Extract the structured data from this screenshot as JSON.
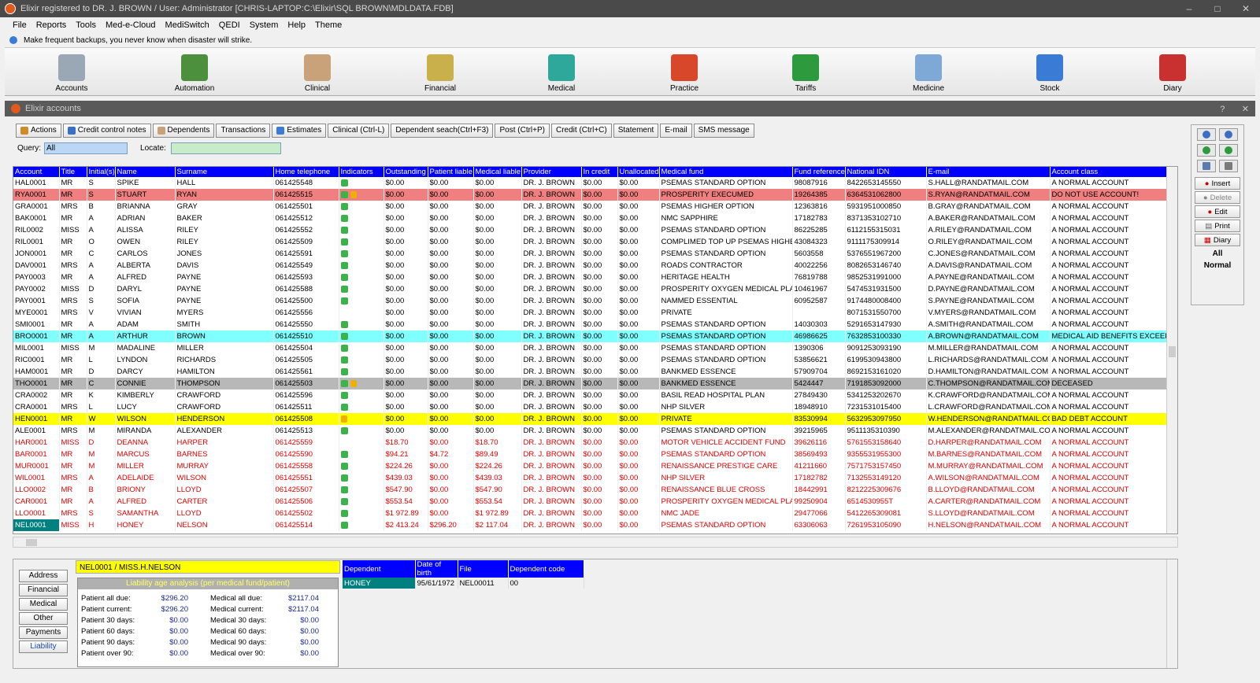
{
  "window": {
    "title": "Elixir registered to DR. J. BROWN / User: Administrator [CHRIS-LAPTOP:C:\\Elixir\\SQL BROWN\\MDLDATA.FDB]",
    "minimize": "–",
    "maximize": "□",
    "close": "✕"
  },
  "menu": [
    "File",
    "Reports",
    "Tools",
    "Med-e-Cloud",
    "MediSwitch",
    "QEDI",
    "System",
    "Help",
    "Theme"
  ],
  "info": "Make frequent backups, you never know when disaster will strike.",
  "modules": [
    {
      "label": "Accounts",
      "color": "#9aa7b4"
    },
    {
      "label": "Automation",
      "color": "#4c8f3c"
    },
    {
      "label": "Clinical",
      "color": "#c9a27a"
    },
    {
      "label": "Financial",
      "color": "#c9b04a"
    },
    {
      "label": "Medical",
      "color": "#2fa89c"
    },
    {
      "label": "Practice",
      "color": "#d9472a"
    },
    {
      "label": "Tariffs",
      "color": "#2e9a3e"
    },
    {
      "label": "Medicine",
      "color": "#7ea9d6"
    },
    {
      "label": "Stock",
      "color": "#3a7bd5"
    },
    {
      "label": "Diary",
      "color": "#c93030"
    }
  ],
  "subwindow": {
    "title": "Elixir accounts",
    "help": "?",
    "close": "✕"
  },
  "toolbar": [
    "Actions",
    "Credit control notes",
    "Dependents",
    "Transactions",
    "Estimates",
    "Clinical (Ctrl-L)",
    "Dependent seach(Ctrl+F3)",
    "Post (Ctrl+P)",
    "Credit (Ctrl+C)",
    "Statement",
    "E-mail",
    "SMS message"
  ],
  "query": {
    "label": "Query:",
    "value": "All",
    "locate_label": "Locate:",
    "locate_value": ""
  },
  "columns": [
    "Account",
    "Title",
    "Initial(s)",
    "Name",
    "Surname",
    "Home telephone",
    "Indicators",
    "Outstanding",
    "Patient liable",
    "Medical liable",
    "Provider",
    "In credit",
    "Unallocated",
    "Medical fund",
    "Fund reference",
    "National IDN",
    "E-mail",
    "Account class"
  ],
  "rows": [
    {
      "c": [
        "HAL0001",
        "MR",
        "S",
        "SPIKE",
        "HALL",
        "061425548",
        "",
        "$0.00",
        "$0.00",
        "$0.00",
        "DR. J. BROWN",
        "$0.00",
        "$0.00",
        "PSEMAS STANDARD OPTION",
        "98087916",
        "8422653145550",
        "S.HALL@RANDATMAIL.COM",
        "A NORMAL ACCOUNT"
      ],
      "style": "",
      "ind": 1
    },
    {
      "c": [
        "RYA0001",
        "MR",
        "S",
        "STUART",
        "RYAN",
        "061425515",
        "",
        "$0.00",
        "$0.00",
        "$0.00",
        "DR. J. BROWN",
        "$0.00",
        "$0.00",
        "PROSPERITY EXECUMED",
        "19264385",
        "6364531062800",
        "S.RYAN@RANDATMAIL.COM",
        "DO NOT USE ACCOUNT!"
      ],
      "style": "hl-red",
      "ind": 2
    },
    {
      "c": [
        "GRA0001",
        "MRS",
        "B",
        "BRIANNA",
        "GRAY",
        "061425501",
        "",
        "$0.00",
        "$0.00",
        "$0.00",
        "DR. J. BROWN",
        "$0.00",
        "$0.00",
        "PSEMAS HIGHER OPTION",
        "12363816",
        "5931951000850",
        "B.GRAY@RANDATMAIL.COM",
        "A NORMAL ACCOUNT"
      ],
      "style": "",
      "ind": 1
    },
    {
      "c": [
        "BAK0001",
        "MR",
        "A",
        "ADRIAN",
        "BAKER",
        "061425512",
        "",
        "$0.00",
        "$0.00",
        "$0.00",
        "DR. J. BROWN",
        "$0.00",
        "$0.00",
        "NMC SAPPHIRE",
        "17182783",
        "8371353102710",
        "A.BAKER@RANDATMAIL.COM",
        "A NORMAL ACCOUNT"
      ],
      "style": "",
      "ind": 1
    },
    {
      "c": [
        "RIL0002",
        "MISS",
        "A",
        "ALISSA",
        "RILEY",
        "061425552",
        "",
        "$0.00",
        "$0.00",
        "$0.00",
        "DR. J. BROWN",
        "$0.00",
        "$0.00",
        "PSEMAS STANDARD OPTION",
        "86225285",
        "6112155315031",
        "A.RILEY@RANDATMAIL.COM",
        "A NORMAL ACCOUNT"
      ],
      "style": "",
      "ind": 1
    },
    {
      "c": [
        "RIL0001",
        "MR",
        "O",
        "OWEN",
        "RILEY",
        "061425509",
        "",
        "$0.00",
        "$0.00",
        "$0.00",
        "DR. J. BROWN",
        "$0.00",
        "$0.00",
        "COMPLIMED TOP UP PSEMAS HIGHER",
        "43084323",
        "9111175309914",
        "O.RILEY@RANDATMAIL.COM",
        "A NORMAL ACCOUNT"
      ],
      "style": "",
      "ind": 1
    },
    {
      "c": [
        "JON0001",
        "MR",
        "C",
        "CARLOS",
        "JONES",
        "061425591",
        "",
        "$0.00",
        "$0.00",
        "$0.00",
        "DR. J. BROWN",
        "$0.00",
        "$0.00",
        "PSEMAS STANDARD OPTION",
        "5603558",
        "5376551967200",
        "C.JONES@RANDATMAIL.COM",
        "A NORMAL ACCOUNT"
      ],
      "style": "",
      "ind": 1
    },
    {
      "c": [
        "DAV0001",
        "MRS",
        "A",
        "ALBERTA",
        "DAVIS",
        "061425549",
        "",
        "$0.00",
        "$0.00",
        "$0.00",
        "DR. J. BROWN",
        "$0.00",
        "$0.00",
        "ROADS CONTRACTOR",
        "40022256",
        "8082653146740",
        "A.DAVIS@RANDATMAIL.COM",
        "A NORMAL ACCOUNT"
      ],
      "style": "",
      "ind": 1
    },
    {
      "c": [
        "PAY0003",
        "MR",
        "A",
        "ALFRED",
        "PAYNE",
        "061425593",
        "",
        "$0.00",
        "$0.00",
        "$0.00",
        "DR. J. BROWN",
        "$0.00",
        "$0.00",
        "HERITAGE HEALTH",
        "76819788",
        "9852531991000",
        "A.PAYNE@RANDATMAIL.COM",
        "A NORMAL ACCOUNT"
      ],
      "style": "",
      "ind": 1
    },
    {
      "c": [
        "PAY0002",
        "MISS",
        "D",
        "DARYL",
        "PAYNE",
        "061425588",
        "",
        "$0.00",
        "$0.00",
        "$0.00",
        "DR. J. BROWN",
        "$0.00",
        "$0.00",
        "PROSPERITY OXYGEN MEDICAL PLAN",
        "10461967",
        "5474531931500",
        "D.PAYNE@RANDATMAIL.COM",
        "A NORMAL ACCOUNT"
      ],
      "style": "",
      "ind": 1
    },
    {
      "c": [
        "PAY0001",
        "MRS",
        "S",
        "SOFIA",
        "PAYNE",
        "061425500",
        "",
        "$0.00",
        "$0.00",
        "$0.00",
        "DR. J. BROWN",
        "$0.00",
        "$0.00",
        "NAMMED ESSENTIAL",
        "60952587",
        "9174480008400",
        "S.PAYNE@RANDATMAIL.COM",
        "A NORMAL ACCOUNT"
      ],
      "style": "",
      "ind": 1
    },
    {
      "c": [
        "MYE0001",
        "MRS",
        "V",
        "VIVIAN",
        "MYERS",
        "061425556",
        "",
        "$0.00",
        "$0.00",
        "$0.00",
        "DR. J. BROWN",
        "$0.00",
        "$0.00",
        "PRIVATE",
        "",
        "8071531550700",
        "V.MYERS@RANDATMAIL.COM",
        "A NORMAL ACCOUNT"
      ],
      "style": "",
      "ind": 0
    },
    {
      "c": [
        "SMI0001",
        "MR",
        "A",
        "ADAM",
        "SMITH",
        "061425550",
        "",
        "$0.00",
        "$0.00",
        "$0.00",
        "DR. J. BROWN",
        "$0.00",
        "$0.00",
        "PSEMAS STANDARD OPTION",
        "14030303",
        "5291653147930",
        "A.SMITH@RANDATMAIL.COM",
        "A NORMAL ACCOUNT"
      ],
      "style": "",
      "ind": 1
    },
    {
      "c": [
        "BRO0001",
        "MR",
        "A",
        "ARTHUR",
        "BROWN",
        "061425510",
        "",
        "$0.00",
        "$0.00",
        "$0.00",
        "DR. J. BROWN",
        "$0.00",
        "$0.00",
        "PSEMAS STANDARD OPTION",
        "46986625",
        "7632853100330",
        "A.BROWN@RANDATMAIL.COM",
        "MEDICAL AID BENEFITS EXCEEDED"
      ],
      "style": "hl-cyan",
      "ind": 1
    },
    {
      "c": [
        "MIL0001",
        "MISS",
        "M",
        "MADALINE",
        "MILLER",
        "061425504",
        "",
        "$0.00",
        "$0.00",
        "$0.00",
        "DR. J. BROWN",
        "$0.00",
        "$0.00",
        "PSEMAS STANDARD OPTION",
        "1390306",
        "9091253093190",
        "M.MILLER@RANDATMAIL.COM",
        "A NORMAL ACCOUNT"
      ],
      "style": "",
      "ind": 1
    },
    {
      "c": [
        "RIC0001",
        "MR",
        "L",
        "LYNDON",
        "RICHARDS",
        "061425505",
        "",
        "$0.00",
        "$0.00",
        "$0.00",
        "DR. J. BROWN",
        "$0.00",
        "$0.00",
        "PSEMAS STANDARD OPTION",
        "53856621",
        "6199530943800",
        "L.RICHARDS@RANDATMAIL.COM",
        "A NORMAL ACCOUNT"
      ],
      "style": "",
      "ind": 1
    },
    {
      "c": [
        "HAM0001",
        "MR",
        "D",
        "DARCY",
        "HAMILTON",
        "061425561",
        "",
        "$0.00",
        "$0.00",
        "$0.00",
        "DR. J. BROWN",
        "$0.00",
        "$0.00",
        "BANKMED ESSENCE",
        "57909704",
        "8692153161020",
        "D.HAMILTON@RANDATMAIL.COM",
        "A NORMAL ACCOUNT"
      ],
      "style": "",
      "ind": 1
    },
    {
      "c": [
        "THO0001",
        "MR",
        "C",
        "CONNIE",
        "THOMPSON",
        "061425503",
        "",
        "$0.00",
        "$0.00",
        "$0.00",
        "DR. J. BROWN",
        "$0.00",
        "$0.00",
        "BANKMED ESSENCE",
        "5424447",
        "7191853092000",
        "C.THOMPSON@RANDATMAIL.COM",
        "DECEASED"
      ],
      "style": "hl-gray",
      "ind": 2
    },
    {
      "c": [
        "CRA0002",
        "MR",
        "K",
        "KIMBERLY",
        "CRAWFORD",
        "061425596",
        "",
        "$0.00",
        "$0.00",
        "$0.00",
        "DR. J. BROWN",
        "$0.00",
        "$0.00",
        "BASIL READ HOSPITAL PLAN",
        "27849430",
        "5341253202670",
        "K.CRAWFORD@RANDATMAIL.COM",
        "A NORMAL ACCOUNT"
      ],
      "style": "",
      "ind": 1
    },
    {
      "c": [
        "CRA0001",
        "MRS",
        "L",
        "LUCY",
        "CRAWFORD",
        "061425511",
        "",
        "$0.00",
        "$0.00",
        "$0.00",
        "DR. J. BROWN",
        "$0.00",
        "$0.00",
        "NHP SILVER",
        "18948910",
        "7231531015400",
        "L.CRAWFORD@RANDATMAIL.COM",
        "A NORMAL ACCOUNT"
      ],
      "style": "",
      "ind": 1
    },
    {
      "c": [
        "HEN0001",
        "MR",
        "W",
        "WILSON",
        "HENDERSON",
        "061425508",
        "",
        "$0.00",
        "$0.00",
        "$0.00",
        "DR. J. BROWN",
        "$0.00",
        "$0.00",
        "PRIVATE",
        "83530994",
        "5632953097950",
        "W.HENDERSON@RANDATMAIL.COM",
        "BAD DEBT ACCOUNT"
      ],
      "style": "hl-yel",
      "ind": 3
    },
    {
      "c": [
        "ALE0001",
        "MRS",
        "M",
        "MIRANDA",
        "ALEXANDER",
        "061425513",
        "",
        "$0.00",
        "$0.00",
        "$0.00",
        "DR. J. BROWN",
        "$0.00",
        "$0.00",
        "PSEMAS STANDARD OPTION",
        "39215965",
        "9511135310390",
        "M.ALEXANDER@RANDATMAIL.COM",
        "A NORMAL ACCOUNT"
      ],
      "style": "",
      "ind": 1
    },
    {
      "c": [
        "HAR0001",
        "MISS",
        "D",
        "DEANNA",
        "HARPER",
        "061425559",
        "",
        "$18.70",
        "$0.00",
        "$18.70",
        "DR. J. BROWN",
        "$0.00",
        "$0.00",
        "MOTOR VEHICLE ACCIDENT FUND",
        "39626116",
        "5761553158640",
        "D.HARPER@RANDATMAIL.COM",
        "A NORMAL ACCOUNT"
      ],
      "style": "red",
      "ind": 0
    },
    {
      "c": [
        "BAR0001",
        "MR",
        "M",
        "MARCUS",
        "BARNES",
        "061425590",
        "",
        "$94.21",
        "$4.72",
        "$89.49",
        "DR. J. BROWN",
        "$0.00",
        "$0.00",
        "PSEMAS STANDARD OPTION",
        "38569493",
        "9355531955300",
        "M.BARNES@RANDATMAIL.COM",
        "A NORMAL ACCOUNT"
      ],
      "style": "red",
      "ind": 1
    },
    {
      "c": [
        "MUR0001",
        "MR",
        "M",
        "MILLER",
        "MURRAY",
        "061425558",
        "",
        "$224.26",
        "$0.00",
        "$224.26",
        "DR. J. BROWN",
        "$0.00",
        "$0.00",
        "RENAISSANCE PRESTIGE CARE",
        "41211660",
        "7571753157450",
        "M.MURRAY@RANDATMAIL.COM",
        "A NORMAL ACCOUNT"
      ],
      "style": "red",
      "ind": 1
    },
    {
      "c": [
        "WIL0001",
        "MRS",
        "A",
        "ADELAIDE",
        "WILSON",
        "061425551",
        "",
        "$439.03",
        "$0.00",
        "$439.03",
        "DR. J. BROWN",
        "$0.00",
        "$0.00",
        "NHP SILVER",
        "17182782",
        "7132553149120",
        "A.WILSON@RANDATMAIL.COM",
        "A NORMAL ACCOUNT"
      ],
      "style": "red",
      "ind": 1
    },
    {
      "c": [
        "LLO0002",
        "MR",
        "B",
        "BRIONY",
        "LLOYD",
        "061425507",
        "",
        "$547.90",
        "$0.00",
        "$547.90",
        "DR. J. BROWN",
        "$0.00",
        "$0.00",
        "RENAISSANCE BLUE CROSS",
        "18442991",
        "8212225309676",
        "B.LLOYD@RANDATMAIL.COM",
        "A NORMAL ACCOUNT"
      ],
      "style": "red",
      "ind": 1
    },
    {
      "c": [
        "CAR0001",
        "MR",
        "A",
        "ALFRED",
        "CARTER",
        "061425506",
        "",
        "$553.54",
        "$0.00",
        "$553.54",
        "DR. J. BROWN",
        "$0.00",
        "$0.00",
        "PROSPERITY OXYGEN MEDICAL PLAN",
        "99250904",
        "6514530955T",
        "A.CARTER@RANDATMAIL.COM",
        "A NORMAL ACCOUNT"
      ],
      "style": "red",
      "ind": 1
    },
    {
      "c": [
        "LLO0001",
        "MRS",
        "S",
        "SAMANTHA",
        "LLOYD",
        "061425502",
        "",
        "$1 972.89",
        "$0.00",
        "$1 972.89",
        "DR. J. BROWN",
        "$0.00",
        "$0.00",
        "NMC JADE",
        "29477066",
        "5412265309081",
        "S.LLOYD@RANDATMAIL.COM",
        "A NORMAL ACCOUNT"
      ],
      "style": "red",
      "ind": 1
    },
    {
      "c": [
        "NEL0001",
        "MISS",
        "H",
        "HONEY",
        "NELSON",
        "061425514",
        "",
        "$2 413.24",
        "$296.20",
        "$2 117.04",
        "DR. J. BROWN",
        "$0.00",
        "$0.00",
        "PSEMAS STANDARD OPTION",
        "63306063",
        "7261953105090",
        "H.NELSON@RANDATMAIL.COM",
        "A NORMAL ACCOUNT"
      ],
      "style": "red",
      "ind": 1,
      "sel": true
    }
  ],
  "right_panel": {
    "insert": "Insert",
    "delete": "Delete",
    "edit": "Edit",
    "print": "Print",
    "diary": "Diary",
    "filter1": "All",
    "filter2": "Normal"
  },
  "side_tabs": [
    "Address",
    "Financial",
    "Medical",
    "Other",
    "Payments",
    "Liability"
  ],
  "patient_banner": "NEL0001 / MISS.H.NELSON",
  "liability": {
    "header": "Liability age analysis (per medical fund/patient)",
    "left": [
      [
        "Patient all due:",
        "$296.20"
      ],
      [
        "Patient current:",
        "$296.20"
      ],
      [
        "Patient 30 days:",
        "$0.00"
      ],
      [
        "Patient 60 days:",
        "$0.00"
      ],
      [
        "Patient 90 days:",
        "$0.00"
      ],
      [
        "Patient over 90:",
        "$0.00"
      ]
    ],
    "right": [
      [
        "Medical all due:",
        "$2117.04"
      ],
      [
        "Medical current:",
        "$2117.04"
      ],
      [
        "Medical 30 days:",
        "$0.00"
      ],
      [
        "Medical 60 days:",
        "$0.00"
      ],
      [
        "Medical 90 days:",
        "$0.00"
      ],
      [
        "Medical over 90:",
        "$0.00"
      ]
    ]
  },
  "dependents": {
    "columns": [
      "Dependent",
      "Date of birth",
      "File",
      "Dependent code"
    ],
    "rows": [
      [
        "HONEY",
        "95/61/1972",
        "NEL00011",
        "00"
      ]
    ]
  }
}
